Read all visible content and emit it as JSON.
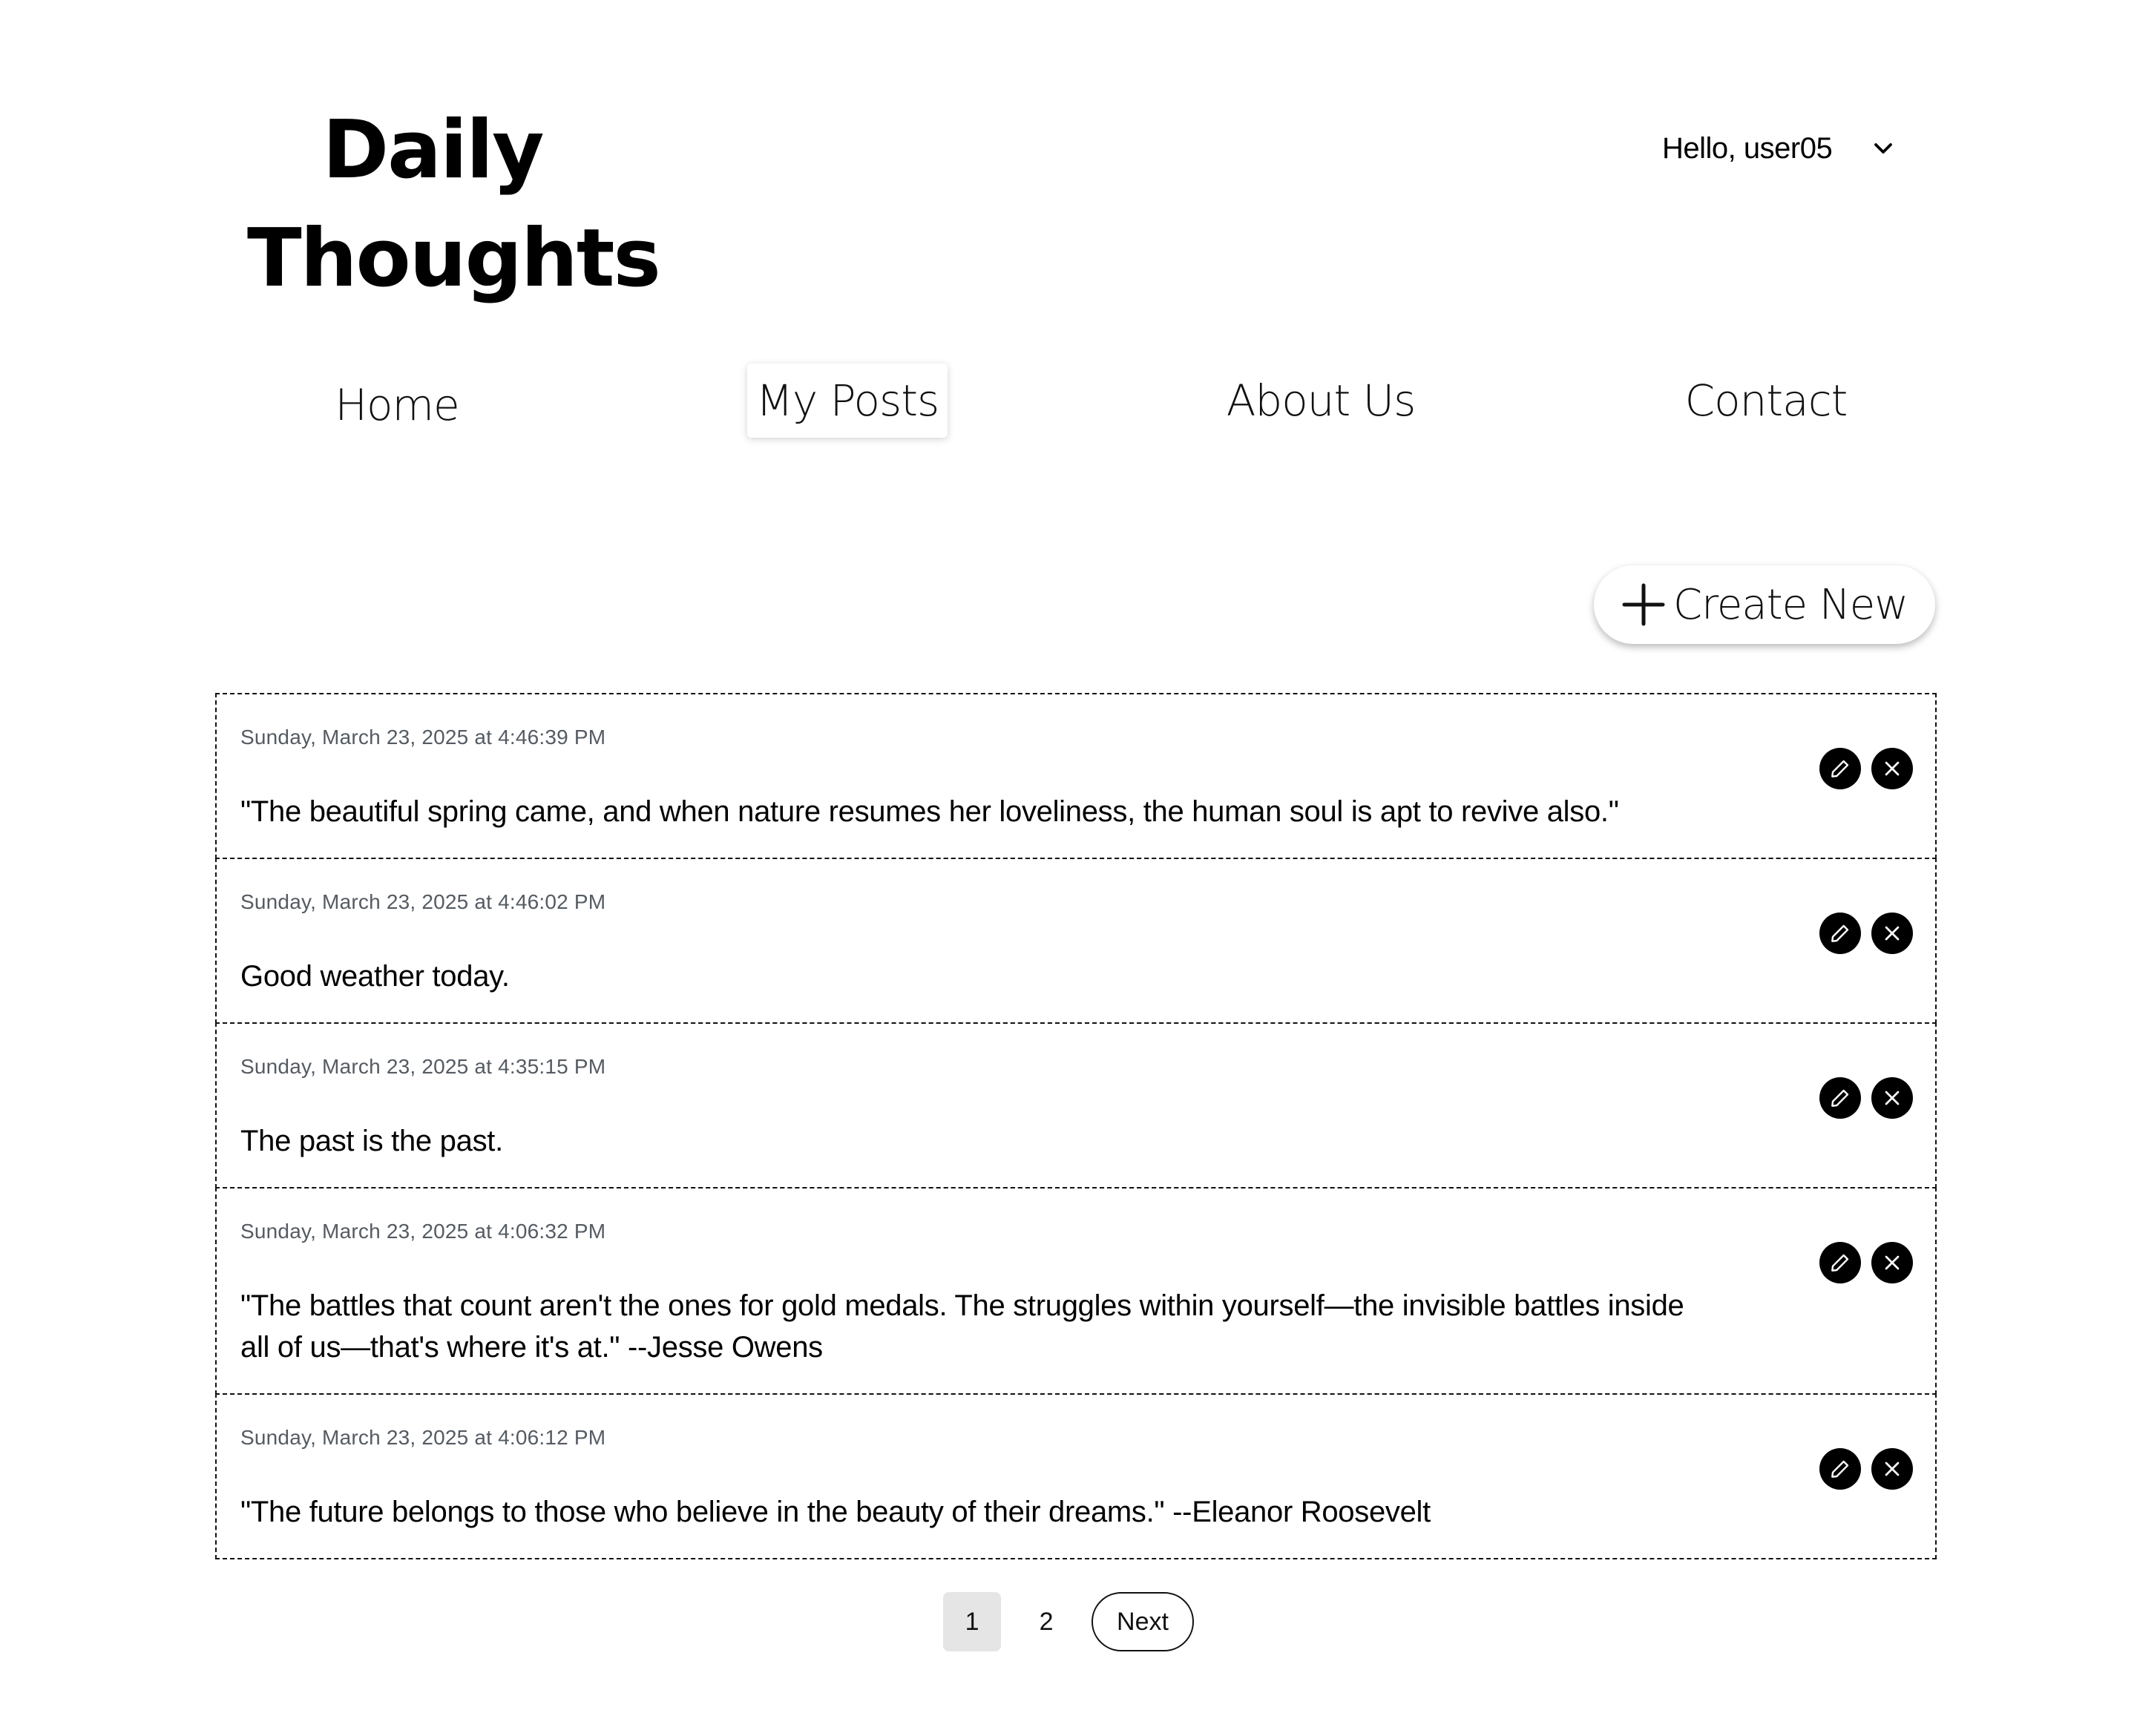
{
  "header": {
    "title_line1": "Daily",
    "title_line2": "Thoughts",
    "user_greeting": "Hello, user05"
  },
  "nav": {
    "items": [
      {
        "label": "Home",
        "active": false
      },
      {
        "label": "My Posts",
        "active": true
      },
      {
        "label": "About Us",
        "active": false
      },
      {
        "label": "Contact",
        "active": false
      }
    ]
  },
  "toolbar": {
    "create_label": "Create New"
  },
  "posts": [
    {
      "date": "Sunday, March 23, 2025 at 4:46:39 PM",
      "text": "\"The beautiful spring came, and when nature resumes her loveliness, the human soul is apt to revive also.\""
    },
    {
      "date": "Sunday, March 23, 2025 at 4:46:02 PM",
      "text": "Good weather today."
    },
    {
      "date": "Sunday, March 23, 2025 at 4:35:15 PM",
      "text": "The past is the past."
    },
    {
      "date": "Sunday, March 23, 2025 at 4:06:32 PM",
      "text": "\"The battles that count aren't the ones for gold medals. The struggles within yourself—the invisible battles inside all of us—that's where it's at.\" --Jesse Owens"
    },
    {
      "date": "Sunday, March 23, 2025 at 4:06:12 PM",
      "text": "\"The future belongs to those who believe in the beauty of their dreams.\" --Eleanor Roosevelt"
    }
  ],
  "post_actions": {
    "edit_icon": "pencil-icon",
    "delete_icon": "close-icon"
  },
  "pagination": {
    "pages": [
      "1",
      "2"
    ],
    "current": "1",
    "next_label": "Next"
  }
}
